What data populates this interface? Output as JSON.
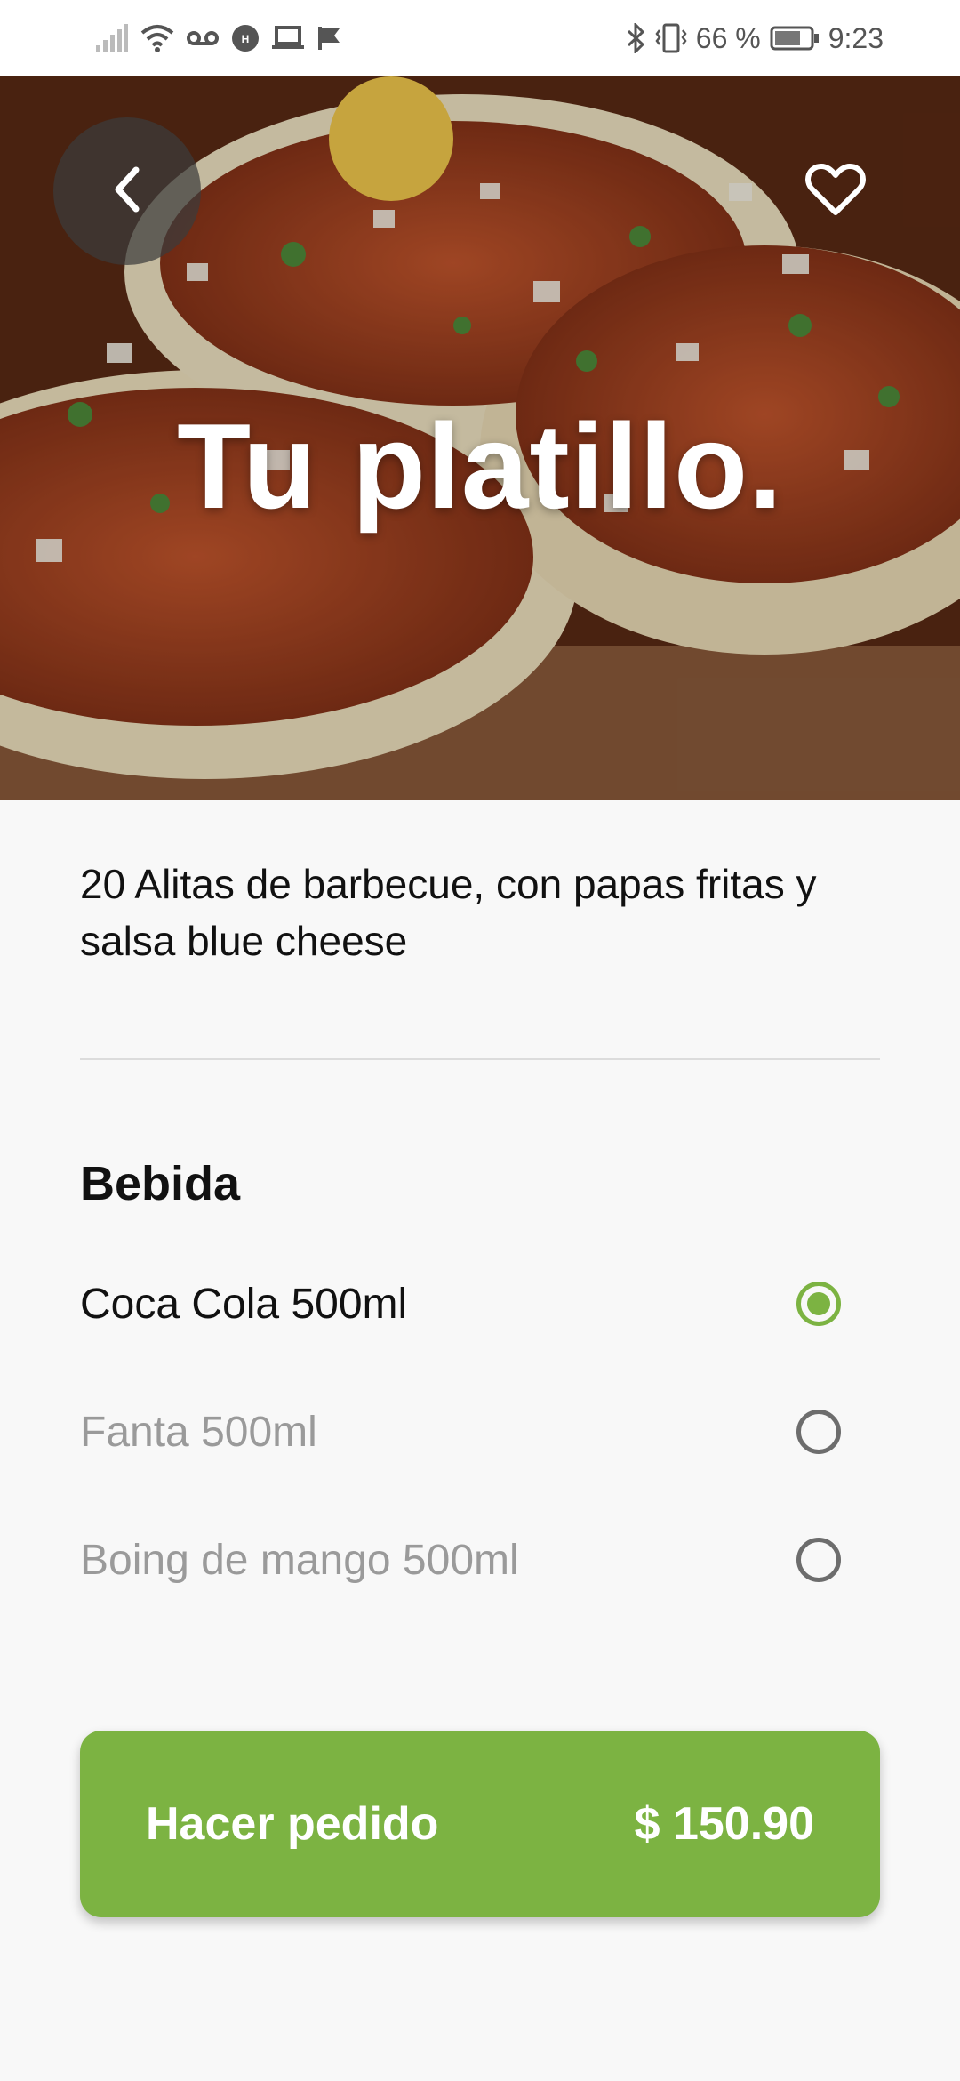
{
  "status_bar": {
    "battery_percent": "66 %",
    "time": "9:23",
    "left_icons": [
      "signal-icon",
      "wifi-icon",
      "voicemail-icon",
      "hm-app-icon",
      "laptop-icon",
      "check-flag-icon"
    ],
    "right_icons": [
      "bluetooth-icon",
      "vibrate-icon",
      "battery-icon"
    ]
  },
  "hero": {
    "title": "Tu platillo.",
    "back_icon": "chevron-left-icon",
    "favorite_icon": "heart-outline-icon"
  },
  "dish": {
    "description": "20 Alitas de barbecue, con papas fritas y salsa blue cheese"
  },
  "drinks": {
    "title": "Bebida",
    "options": [
      {
        "label": "Coca Cola 500ml",
        "selected": true
      },
      {
        "label": "Fanta  500ml",
        "selected": false
      },
      {
        "label": "Boing de mango  500ml",
        "selected": false
      }
    ]
  },
  "order": {
    "label": "Hacer pedido",
    "price": "$ 150.90"
  },
  "colors": {
    "accent": "#7cb342",
    "muted_text": "#9a9a9a"
  }
}
